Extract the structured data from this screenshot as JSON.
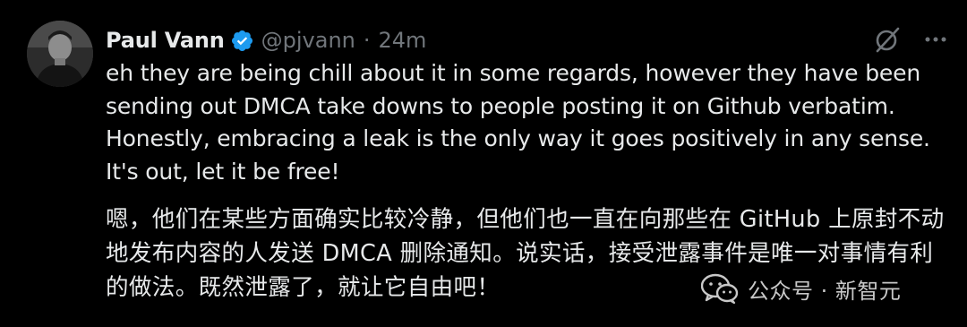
{
  "tweet": {
    "author": {
      "display_name": "Paul Vann",
      "handle": "@pjvann",
      "verified": true,
      "avatar_icon": "user-avatar-photo"
    },
    "separator": "·",
    "timestamp": "24m",
    "actions": {
      "grok_icon": "grok-slash-circle-icon",
      "more_icon": "more-horizontal-icon"
    },
    "text_en": "eh they are being chill about it in some regards, however they have been sending out DMCA take downs to people posting it on Github verbatim. Honestly, embracing a leak is the only way it goes positively in any sense. It's out, let it be free!",
    "text_zh": "嗯，他们在某些方面确实比较冷静，但他们也一直在向那些在 GitHub 上原封不动地发布内容的人发送 DMCA 删除通知。说实话，接受泄露事件是唯一对事情有利的做法。既然泄露了，就让它自由吧！"
  },
  "watermark": {
    "icon": "wechat-icon",
    "text": "公众号 · 新智元"
  },
  "colors": {
    "background": "#000000",
    "text_primary": "#e7e9ea",
    "text_secondary": "#71767b",
    "verified_blue": "#1d9bf0"
  }
}
